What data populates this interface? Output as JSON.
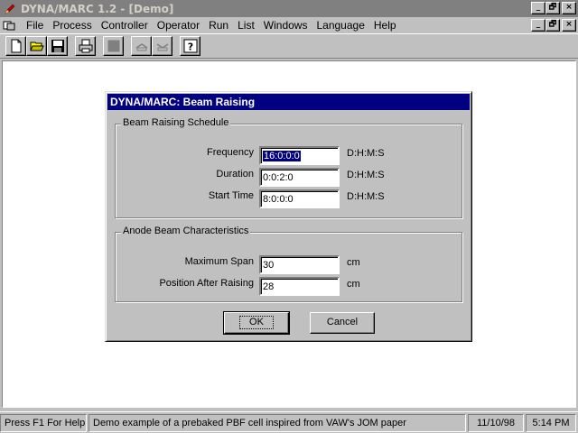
{
  "window": {
    "title": "DYNA/MARC 1.2 - [Demo]",
    "app_icon": "pen-icon",
    "minimize_glyph": "_",
    "restore_glyph": "🗗",
    "close_glyph": "×"
  },
  "menu": {
    "items": [
      {
        "label": "File"
      },
      {
        "label": "Process"
      },
      {
        "label": "Controller"
      },
      {
        "label": "Operator"
      },
      {
        "label": "Run"
      },
      {
        "label": "List"
      },
      {
        "label": "Windows"
      },
      {
        "label": "Language"
      },
      {
        "label": "Help"
      }
    ]
  },
  "toolbar": {
    "buttons": [
      "new-file-icon",
      "open-folder-icon",
      "save-disk-icon",
      "print-icon",
      "blank-icon",
      "send-icon",
      "receive-icon",
      "help-icon"
    ]
  },
  "dialog": {
    "title": "DYNA/MARC: Beam Raising",
    "schedule": {
      "legend": "Beam Raising Schedule",
      "frequency_label": "Frequency",
      "frequency_value": "16:0:0:0",
      "frequency_unit": "D:H:M:S",
      "duration_label": "Duration",
      "duration_value": "0:0:2:0",
      "duration_unit": "D:H:M:S",
      "start_label": "Start Time",
      "start_value": "8:0:0:0",
      "start_unit": "D:H:M:S"
    },
    "anode": {
      "legend": "Anode Beam Characteristics",
      "span_label": "Maximum Span",
      "span_value": "30",
      "span_unit": "cm",
      "position_label": "Position After Raising",
      "position_value": "28",
      "position_unit": "cm"
    },
    "ok_label": "OK",
    "cancel_label": "Cancel"
  },
  "status": {
    "help": "Press F1 For Help",
    "message": "Demo example of a prebaked PBF cell inspired from VAW's JOM paper",
    "date": "11/10/98",
    "time": "5:14 PM"
  },
  "colors": {
    "title_inactive": "#808080",
    "dialog_title": "#000080",
    "face": "#c0c0c0"
  }
}
